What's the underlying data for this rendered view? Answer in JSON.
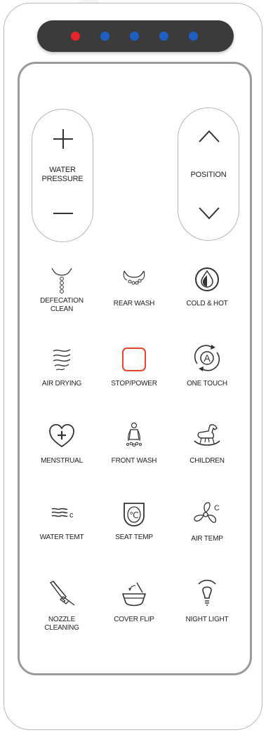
{
  "leds": [
    {
      "name": "led-1",
      "color": "#e8252a"
    },
    {
      "name": "led-2",
      "color": "#1e5fc4"
    },
    {
      "name": "led-3",
      "color": "#1e5fc4"
    },
    {
      "name": "led-4",
      "color": "#1e5fc4"
    },
    {
      "name": "led-5",
      "color": "#1e5fc4"
    }
  ],
  "water_pressure": {
    "label": "WATER\nPRESSURE",
    "increase_icon": "plus-icon",
    "decrease_icon": "minus-icon"
  },
  "position": {
    "label": "POSITION",
    "up_icon": "chevron-up-icon",
    "down_icon": "chevron-down-icon"
  },
  "buttons": {
    "defecation_clean": "DEFECATION\nCLEAN",
    "rear_wash": "REAR WASH",
    "cold_hot": "COLD & HOT",
    "air_drying": "AIR DRYING",
    "stop_power": "STOP/POWER",
    "one_touch": "ONE TOUCH",
    "menstrual": "MENSTRUAL",
    "front_wash": "FRONT WASH",
    "children": "CHILDREN",
    "water_temt": "WATER TEMT",
    "seat_temp": "SEAT TEMP",
    "air_temp": "AIR TEMP",
    "nozzle_cleaning": "NOZZLE\nCLEANING",
    "cover_flip": "COVER FLIP",
    "night_light": "NIGHT LIGHT"
  },
  "icon_glyphs": {
    "one_touch": "A",
    "seat_temp": "℃",
    "water_temp": "c",
    "air_temp": "C"
  },
  "colors": {
    "stop_power_accent": "#e8452a",
    "led_bar": "#3b3b3b"
  }
}
